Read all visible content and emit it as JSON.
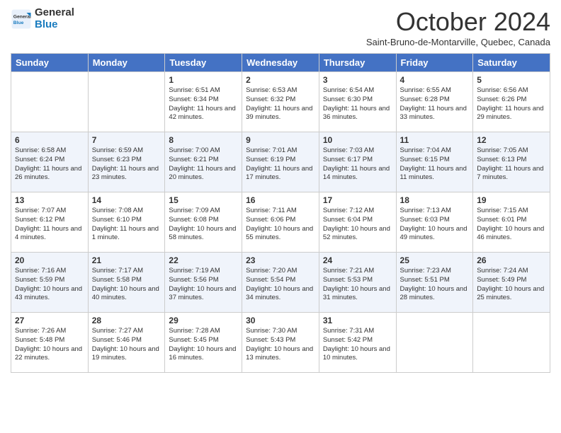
{
  "header": {
    "logo_general": "General",
    "logo_blue": "Blue",
    "month_title": "October 2024",
    "subtitle": "Saint-Bruno-de-Montarville, Quebec, Canada"
  },
  "days_of_week": [
    "Sunday",
    "Monday",
    "Tuesday",
    "Wednesday",
    "Thursday",
    "Friday",
    "Saturday"
  ],
  "weeks": [
    [
      {
        "day": "",
        "info": ""
      },
      {
        "day": "",
        "info": ""
      },
      {
        "day": "1",
        "info": "Sunrise: 6:51 AM\nSunset: 6:34 PM\nDaylight: 11 hours and 42 minutes."
      },
      {
        "day": "2",
        "info": "Sunrise: 6:53 AM\nSunset: 6:32 PM\nDaylight: 11 hours and 39 minutes."
      },
      {
        "day": "3",
        "info": "Sunrise: 6:54 AM\nSunset: 6:30 PM\nDaylight: 11 hours and 36 minutes."
      },
      {
        "day": "4",
        "info": "Sunrise: 6:55 AM\nSunset: 6:28 PM\nDaylight: 11 hours and 33 minutes."
      },
      {
        "day": "5",
        "info": "Sunrise: 6:56 AM\nSunset: 6:26 PM\nDaylight: 11 hours and 29 minutes."
      }
    ],
    [
      {
        "day": "6",
        "info": "Sunrise: 6:58 AM\nSunset: 6:24 PM\nDaylight: 11 hours and 26 minutes."
      },
      {
        "day": "7",
        "info": "Sunrise: 6:59 AM\nSunset: 6:23 PM\nDaylight: 11 hours and 23 minutes."
      },
      {
        "day": "8",
        "info": "Sunrise: 7:00 AM\nSunset: 6:21 PM\nDaylight: 11 hours and 20 minutes."
      },
      {
        "day": "9",
        "info": "Sunrise: 7:01 AM\nSunset: 6:19 PM\nDaylight: 11 hours and 17 minutes."
      },
      {
        "day": "10",
        "info": "Sunrise: 7:03 AM\nSunset: 6:17 PM\nDaylight: 11 hours and 14 minutes."
      },
      {
        "day": "11",
        "info": "Sunrise: 7:04 AM\nSunset: 6:15 PM\nDaylight: 11 hours and 11 minutes."
      },
      {
        "day": "12",
        "info": "Sunrise: 7:05 AM\nSunset: 6:13 PM\nDaylight: 11 hours and 7 minutes."
      }
    ],
    [
      {
        "day": "13",
        "info": "Sunrise: 7:07 AM\nSunset: 6:12 PM\nDaylight: 11 hours and 4 minutes."
      },
      {
        "day": "14",
        "info": "Sunrise: 7:08 AM\nSunset: 6:10 PM\nDaylight: 11 hours and 1 minute."
      },
      {
        "day": "15",
        "info": "Sunrise: 7:09 AM\nSunset: 6:08 PM\nDaylight: 10 hours and 58 minutes."
      },
      {
        "day": "16",
        "info": "Sunrise: 7:11 AM\nSunset: 6:06 PM\nDaylight: 10 hours and 55 minutes."
      },
      {
        "day": "17",
        "info": "Sunrise: 7:12 AM\nSunset: 6:04 PM\nDaylight: 10 hours and 52 minutes."
      },
      {
        "day": "18",
        "info": "Sunrise: 7:13 AM\nSunset: 6:03 PM\nDaylight: 10 hours and 49 minutes."
      },
      {
        "day": "19",
        "info": "Sunrise: 7:15 AM\nSunset: 6:01 PM\nDaylight: 10 hours and 46 minutes."
      }
    ],
    [
      {
        "day": "20",
        "info": "Sunrise: 7:16 AM\nSunset: 5:59 PM\nDaylight: 10 hours and 43 minutes."
      },
      {
        "day": "21",
        "info": "Sunrise: 7:17 AM\nSunset: 5:58 PM\nDaylight: 10 hours and 40 minutes."
      },
      {
        "day": "22",
        "info": "Sunrise: 7:19 AM\nSunset: 5:56 PM\nDaylight: 10 hours and 37 minutes."
      },
      {
        "day": "23",
        "info": "Sunrise: 7:20 AM\nSunset: 5:54 PM\nDaylight: 10 hours and 34 minutes."
      },
      {
        "day": "24",
        "info": "Sunrise: 7:21 AM\nSunset: 5:53 PM\nDaylight: 10 hours and 31 minutes."
      },
      {
        "day": "25",
        "info": "Sunrise: 7:23 AM\nSunset: 5:51 PM\nDaylight: 10 hours and 28 minutes."
      },
      {
        "day": "26",
        "info": "Sunrise: 7:24 AM\nSunset: 5:49 PM\nDaylight: 10 hours and 25 minutes."
      }
    ],
    [
      {
        "day": "27",
        "info": "Sunrise: 7:26 AM\nSunset: 5:48 PM\nDaylight: 10 hours and 22 minutes."
      },
      {
        "day": "28",
        "info": "Sunrise: 7:27 AM\nSunset: 5:46 PM\nDaylight: 10 hours and 19 minutes."
      },
      {
        "day": "29",
        "info": "Sunrise: 7:28 AM\nSunset: 5:45 PM\nDaylight: 10 hours and 16 minutes."
      },
      {
        "day": "30",
        "info": "Sunrise: 7:30 AM\nSunset: 5:43 PM\nDaylight: 10 hours and 13 minutes."
      },
      {
        "day": "31",
        "info": "Sunrise: 7:31 AM\nSunset: 5:42 PM\nDaylight: 10 hours and 10 minutes."
      },
      {
        "day": "",
        "info": ""
      },
      {
        "day": "",
        "info": ""
      }
    ]
  ]
}
